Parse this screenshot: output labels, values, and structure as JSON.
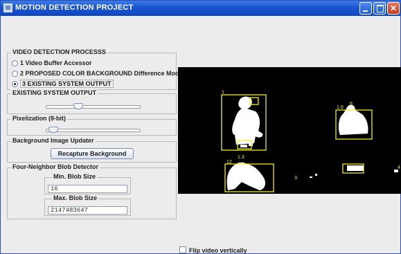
{
  "window": {
    "title": "MOTION DETECTION PROJECT"
  },
  "detection_group": {
    "legend": "VIDEO DETECTION PROCESSS",
    "options": [
      {
        "label": "1 Video Buffer Accessor",
        "selected": false
      },
      {
        "label": "2 PROPOSED COLOR BACKGROUND Difference Model",
        "selected": false
      },
      {
        "label": "3 EXISTING SYSTEM OUTPUT",
        "selected": true
      }
    ]
  },
  "existing_output": {
    "legend": "EXISTING SYSTEM OUTPUT",
    "slider_value": 0.33
  },
  "pixelization": {
    "legend": "Pixelization (8-bit)",
    "slider_value": 0.03
  },
  "background": {
    "legend": "Background Image Updater",
    "button": "Recapture Background"
  },
  "blob": {
    "legend": "Four-Neighbor Blob Detector",
    "min_label": "Min. Blob Size",
    "min_value": "16",
    "max_label": "Max. Blob Size",
    "max_value": "2147483647"
  },
  "video": {
    "labels": [
      "1",
      "12",
      "1.3",
      "1.0",
      "4",
      "3",
      "6"
    ],
    "box_color": "#f2ee2a"
  },
  "flip_label": "Flip video vertically"
}
